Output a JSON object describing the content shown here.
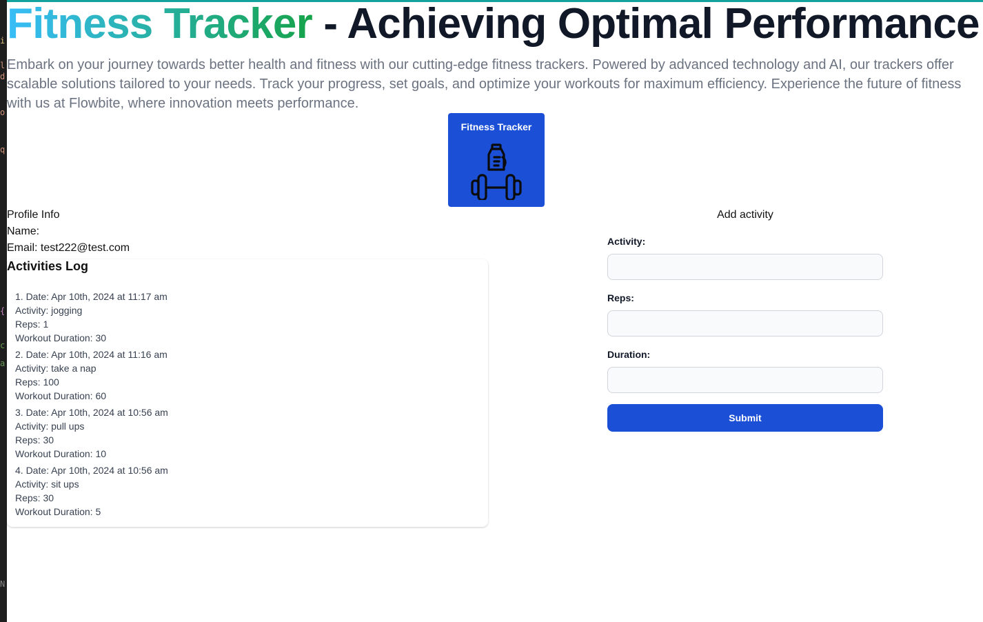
{
  "hero": {
    "title_highlight": "Fitness Tracker",
    "title_rest": " - Achieving Optimal Performance",
    "description": "Embark on your journey towards better health and fitness with our cutting-edge fitness trackers. Powered by advanced technology and AI, our trackers offer scalable solutions tailored to your needs. Track your progress, set goals, and optimize your workouts for maximum efficiency. Experience the future of fitness with us at Flowbite, where innovation meets performance."
  },
  "tracker_card": {
    "title": "Fitness Tracker",
    "icon": "fitness-bottle-dumbbell-icon"
  },
  "profile": {
    "heading": "Profile Info",
    "name_label": "Name:",
    "email_line": "Email: test222@test.com"
  },
  "activities_log": {
    "heading": "Activities Log",
    "entries": [
      {
        "date": "1. Date: Apr 10th, 2024 at 11:17 am",
        "activity": "Activity: jogging",
        "reps": "Reps: 1",
        "duration": "Workout Duration: 30"
      },
      {
        "date": "2. Date: Apr 10th, 2024 at 11:16 am",
        "activity": "Activity: take a nap",
        "reps": "Reps: 100",
        "duration": "Workout Duration: 60"
      },
      {
        "date": "3. Date: Apr 10th, 2024 at 10:56 am",
        "activity": "Activity: pull ups",
        "reps": "Reps: 30",
        "duration": "Workout Duration: 10"
      },
      {
        "date": "4. Date: Apr 10th, 2024 at 10:56 am",
        "activity": "Activity: sit ups",
        "reps": "Reps: 30",
        "duration": "Workout Duration: 5"
      }
    ]
  },
  "add_activity": {
    "heading": "Add activity",
    "activity_label": "Activity:",
    "activity_value": "",
    "reps_label": "Reps:",
    "reps_value": "",
    "duration_label": "Duration:",
    "duration_value": "",
    "submit_label": "Submit"
  },
  "colors": {
    "accent_blue": "#1a4fd6",
    "gradient_start": "#38bdf8",
    "gradient_end": "#16a34a",
    "top_line": "#13a39c"
  }
}
